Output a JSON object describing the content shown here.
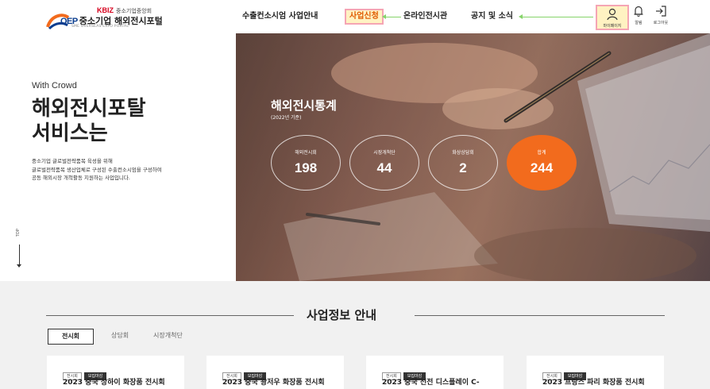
{
  "header": {
    "logo": {
      "org": "KBIZ",
      "org_sub": "중소기업중앙회",
      "main_brand": "OEP",
      "main_text": "중소기업 해외전시포털",
      "sub_text": "SME OVERSEAS EXPO PORTAL"
    },
    "nav": [
      {
        "label": "수출컨소시엄 사업안내"
      },
      {
        "label": "사업신청"
      },
      {
        "label": "온라인전시관"
      },
      {
        "label": "공지 및 소식"
      }
    ],
    "utils": {
      "mypage": "마이페이지",
      "alarm": "알림",
      "logout": "로그아웃"
    },
    "highlight_color": "#f5a5b4",
    "highlight_fill": "#fff2c2",
    "arrow_color": "#86d46a"
  },
  "hero": {
    "eyebrow": "With Crowd",
    "title_line1": "해외전시포탈",
    "title_line2": "서비스는",
    "desc_line1": "중소기업 글로벌전략품목 육성을 위해",
    "desc_line2": "글로벌전략품목 생산업체로 구성된 수출컨소시엄을 구성하여",
    "desc_line3": "공동 해외시장 개척활동 지원하는 사업입니다.",
    "top_label": "TOP"
  },
  "stats": {
    "title": "해외전시통계",
    "subtitle": "(2022년 기준)",
    "items": [
      {
        "label": "해외전시회",
        "value": "198"
      },
      {
        "label": "시장개척단",
        "value": "44"
      },
      {
        "label": "화상상담회",
        "value": "2"
      },
      {
        "label": "합계",
        "value": "244"
      }
    ],
    "accent_color": "#f26b1d"
  },
  "business": {
    "title": "사업정보 안내",
    "tabs": [
      {
        "label": "전시회"
      },
      {
        "label": "상담회"
      },
      {
        "label": "시장개척단"
      }
    ],
    "cards": [
      {
        "badge1": "전시회",
        "badge2": "모집마감",
        "title": "2023 중국 상하이 화장품 전시회"
      },
      {
        "badge1": "전시회",
        "badge2": "모집마감",
        "title": "2023 중국 광저우 화장품 전시회"
      },
      {
        "badge1": "전시회",
        "badge2": "모집마감",
        "title": "2023 중국 선전 디스플레이 C-"
      },
      {
        "badge1": "전시회",
        "badge2": "모집마감",
        "title": "2023 프랑스 파리 화장품 전시회"
      }
    ]
  }
}
